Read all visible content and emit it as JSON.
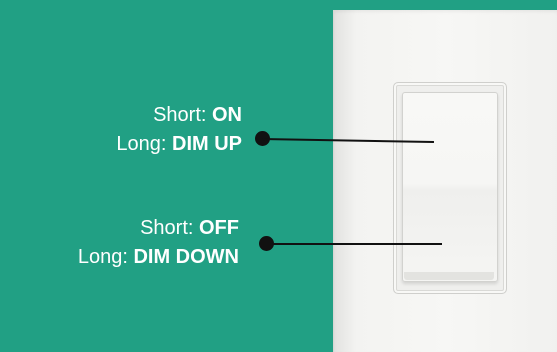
{
  "top_zone": {
    "short_label": "Short:",
    "short_action": "ON",
    "long_label": "Long:",
    "long_action": "DIM UP"
  },
  "bottom_zone": {
    "short_label": "Short:",
    "short_action": "OFF",
    "long_label": "Long:",
    "long_action": "DIM DOWN"
  },
  "colors": {
    "background": "#21a084",
    "text": "#ffffff",
    "leader": "#111111",
    "plate": "#f5f5f3"
  }
}
